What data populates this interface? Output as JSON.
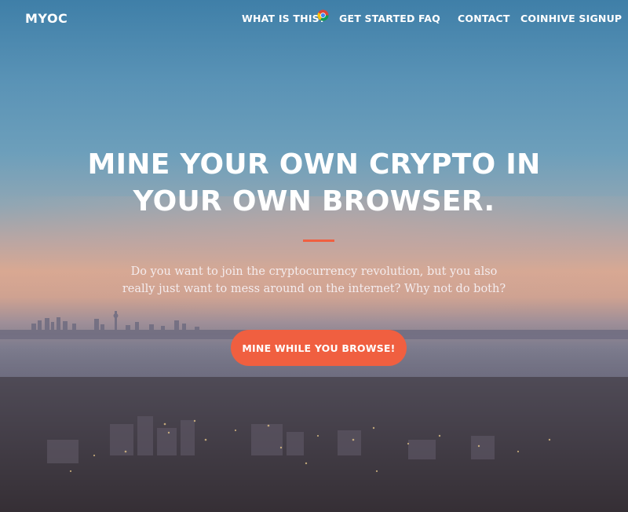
{
  "nav": {
    "brand": "MYOC",
    "items": [
      {
        "label": "WHAT IS THIS?"
      },
      {
        "label": "GET STARTED",
        "icon": "chrome-icon"
      },
      {
        "label": "FAQ"
      },
      {
        "label": "CONTACT"
      },
      {
        "label": "COINHIVE SIGNUP"
      }
    ]
  },
  "hero": {
    "title_line1": "MINE YOUR OWN CRYPTO IN",
    "title_line2": "YOUR OWN BROWSER.",
    "text_line1": "Do you want to join the cryptocurrency revolution, but you also",
    "text_line2": "really just want to mess around on the internet? Why not do both?",
    "cta_label": "MINE WHILE YOU BROWSE!"
  },
  "colors": {
    "accent": "#f05f40",
    "text": "#ffffff"
  }
}
